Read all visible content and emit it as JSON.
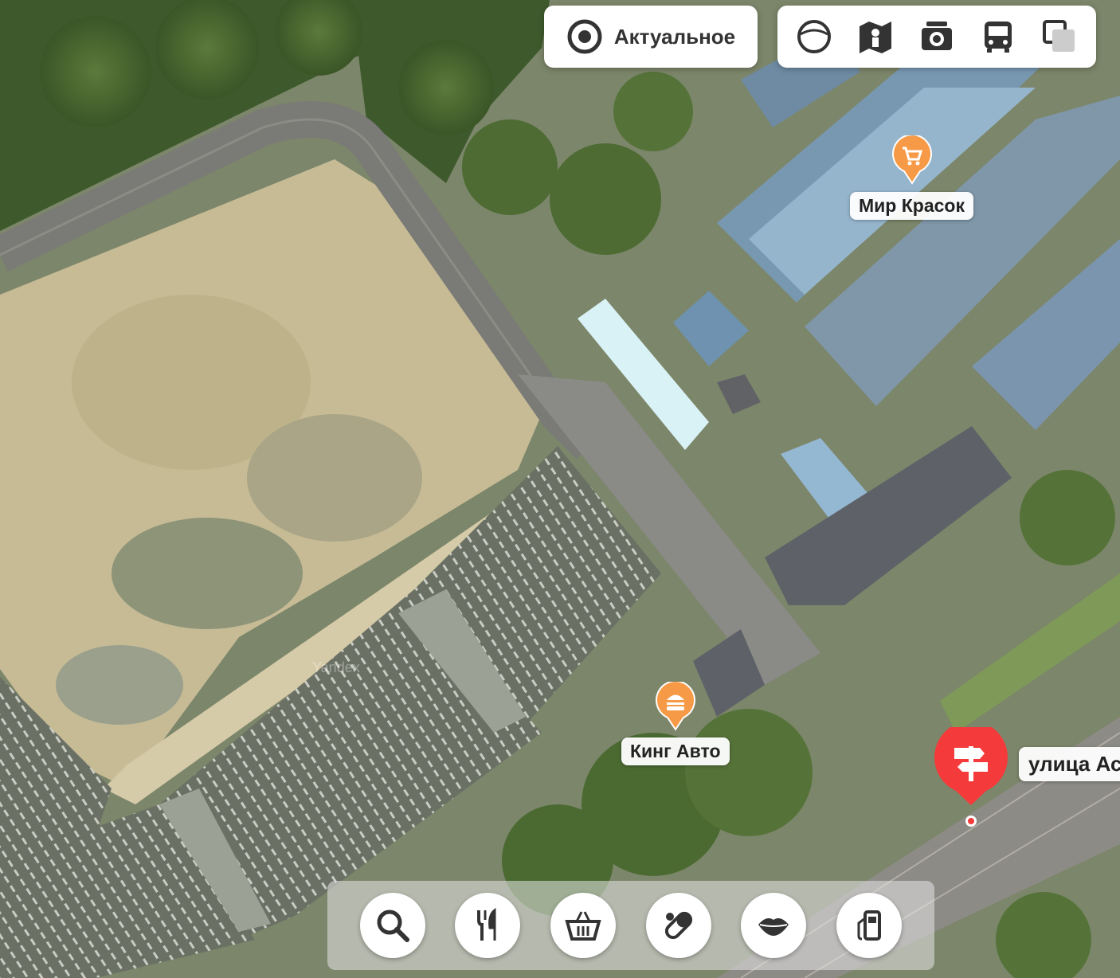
{
  "top_controls": {
    "actual_label": "Актуальное",
    "layers": [
      {
        "name": "panorama-sphere-icon"
      },
      {
        "name": "map-layer-icon"
      },
      {
        "name": "photo-camera-icon"
      },
      {
        "name": "transport-bus-icon"
      },
      {
        "name": "map-style-switch-icon"
      }
    ]
  },
  "pois": {
    "mir_krasok": {
      "label": "Мир Красок",
      "icon": "shopping-cart-icon",
      "color": "#f79a47"
    },
    "king_avto": {
      "label": "Кинг Авто",
      "icon": "burger-icon",
      "color": "#f79a47"
    },
    "street": {
      "label": "улица Ас",
      "icon": "signpost-icon",
      "color": "#f43a3a"
    }
  },
  "watermark": "Yandex",
  "categories": [
    {
      "name": "search-icon"
    },
    {
      "name": "food-fork-knife-icon"
    },
    {
      "name": "shopping-basket-icon"
    },
    {
      "name": "pharmacy-pill-icon"
    },
    {
      "name": "beauty-lips-icon"
    },
    {
      "name": "gas-station-icon"
    }
  ]
}
